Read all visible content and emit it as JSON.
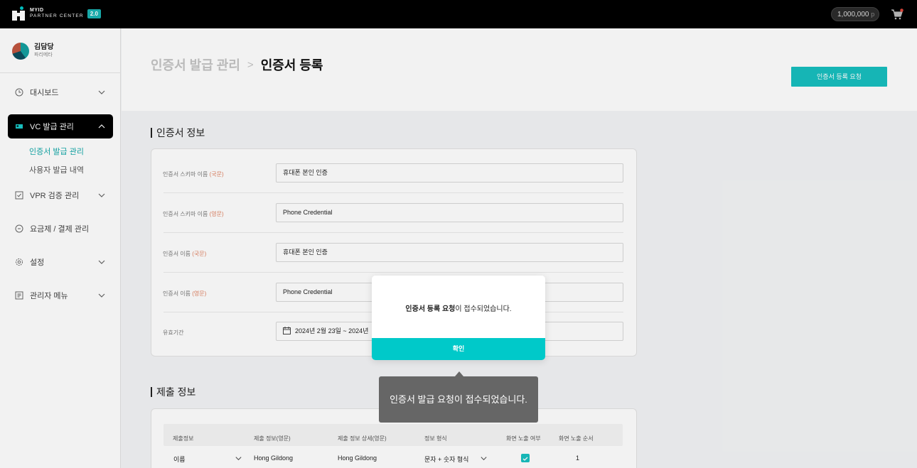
{
  "topbar": {
    "logo_line1": "MYID",
    "logo_line2": "PARTNER CENTER",
    "version": "2.0",
    "points_value": "1,000,000",
    "points_unit": "p"
  },
  "profile": {
    "name": "김담당",
    "role": "파리메타"
  },
  "sidebar": {
    "items": [
      {
        "label": "대시보드"
      },
      {
        "label": "VC 발급 관리"
      },
      {
        "label": "VPR 검증 관리"
      },
      {
        "label": "요금제 / 결제 관리"
      },
      {
        "label": "설정"
      },
      {
        "label": "관리자 메뉴"
      }
    ],
    "sub_items": [
      {
        "label": "인증서 발급 관리"
      },
      {
        "label": "사용자 발급 내역"
      }
    ]
  },
  "header": {
    "breadcrumb_parent": "인증서 발급 관리",
    "breadcrumb_sep": ">",
    "breadcrumb_current": "인증서 등록",
    "request_button": "인증서 등록 요청"
  },
  "cert_section": {
    "title": "인증서 정보",
    "rows": [
      {
        "label": "인증서 스키마 이름",
        "lang": "(국문)",
        "value": "휴대폰 본인 인증"
      },
      {
        "label": "인증서 스키마 이름",
        "lang": "(영문)",
        "value": "Phone Credential"
      },
      {
        "label": "인증서 이름",
        "lang": "(국문)",
        "value": "휴대폰 본인 인증"
      },
      {
        "label": "인증서 이름",
        "lang": "(영문)",
        "value": "Phone Credential"
      },
      {
        "label": "유효기간",
        "lang": "",
        "value": "2024년 2월 23일 ~ 2024년"
      }
    ]
  },
  "submit_section": {
    "title": "제출 정보",
    "columns": [
      "제출정보",
      "제출 정보(영문)",
      "제출 정보 상세(영문)",
      "정보 형식",
      "화면 노출 여부",
      "화면 노출 순서"
    ],
    "row": {
      "name": "이름",
      "en": "Hong Gildong",
      "detail_en": "Hong Gildong",
      "format": "문자 + 숫자 형식",
      "visible": true,
      "order": "1"
    }
  },
  "modal": {
    "message_bold": "인증서 등록 요청",
    "message_rest": "이 접수되었습니다.",
    "confirm_button": "확인"
  },
  "tooltip": {
    "text": "인증서 발급 요청이 접수되었습니다."
  },
  "colors": {
    "accent": "#00c9c9",
    "brand_dark": "#000000",
    "tooltip_bg": "#666666"
  }
}
